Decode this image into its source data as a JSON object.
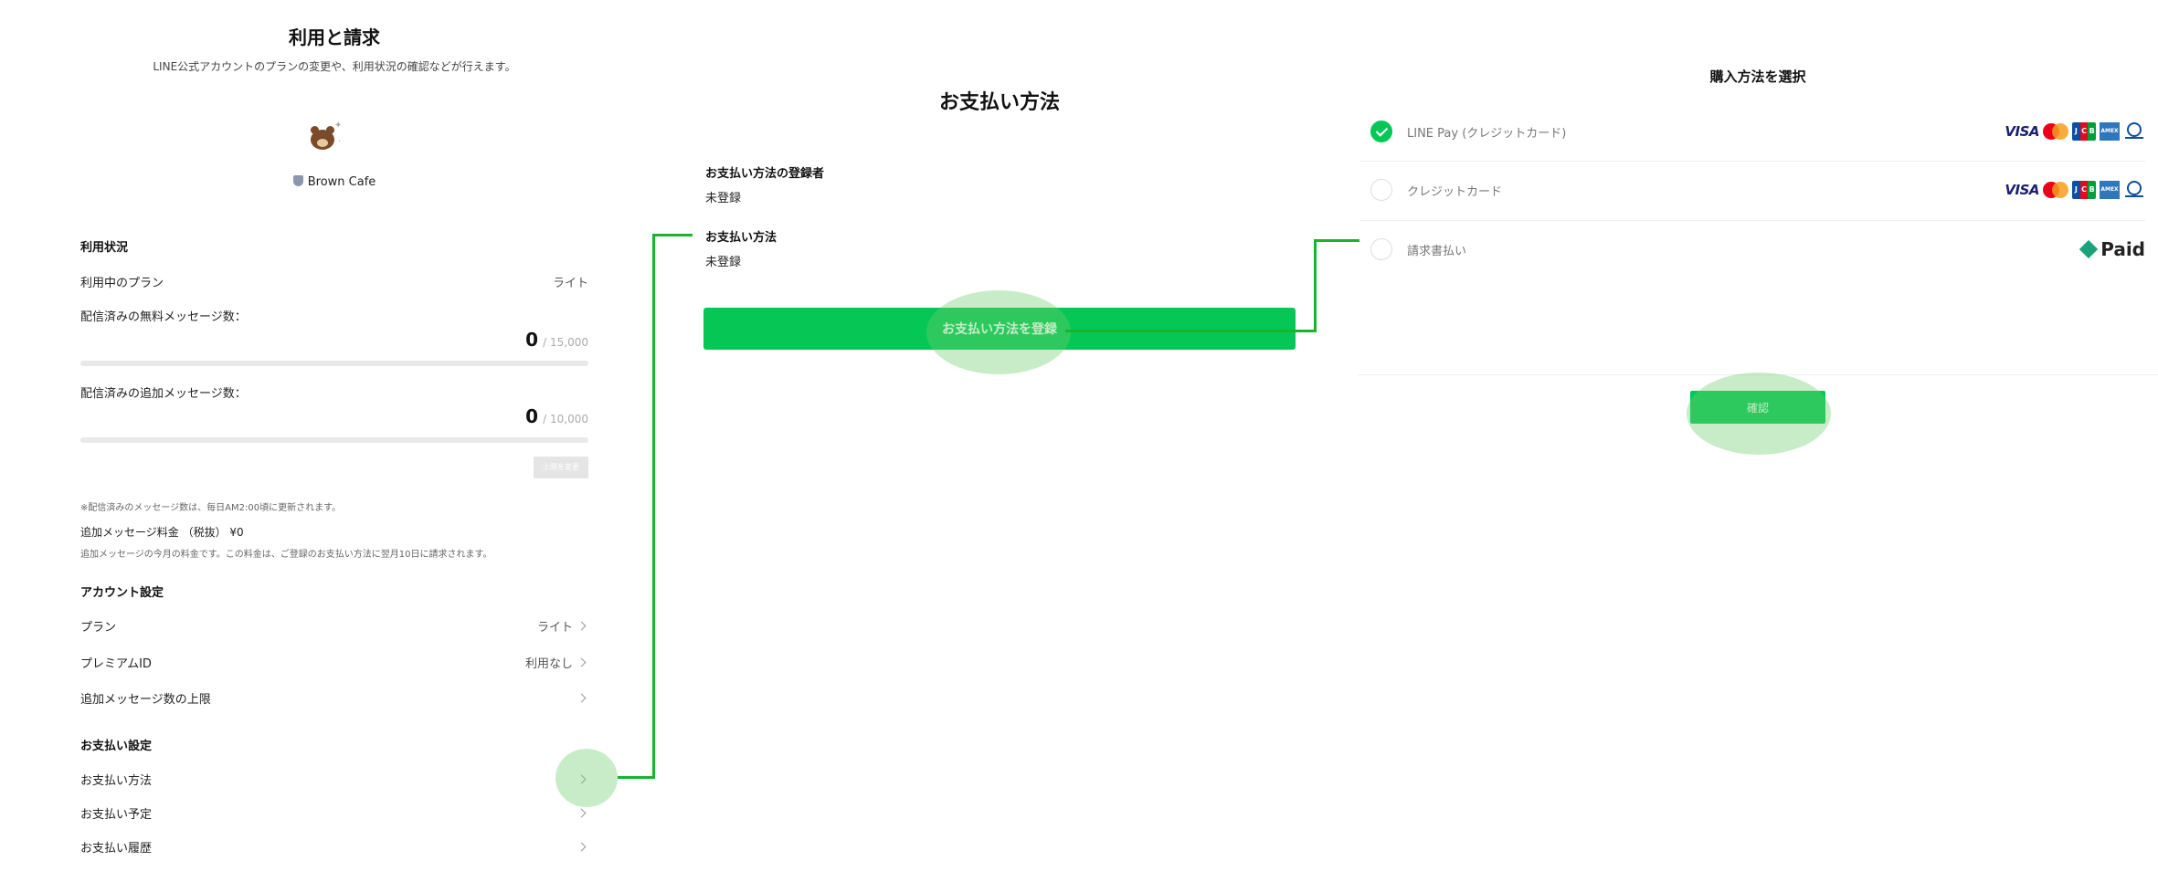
{
  "usage": {
    "title": "利用と請求",
    "subtitle": "LINE公式アカウントのプランの変更や、利用状況の確認などが行えます。",
    "account_name": "Brown Cafe",
    "status_heading": "利用状況",
    "current_plan_label": "利用中のプラン",
    "current_plan_value": "ライト",
    "free_msg_label": "配信済みの無料メッセージ数：",
    "free_msg_count": "0",
    "free_msg_limit": "/ 15,000",
    "extra_msg_label": "配信済みの追加メッセージ数：",
    "extra_msg_count": "0",
    "extra_msg_limit": "/ 10,000",
    "upper_limit_button": "上限を変更",
    "update_note": "※配信済みのメッセージ数は、毎日AM2:00頃に更新されます。",
    "extra_fee_label": "追加メッセージ料金 （税抜） ¥0",
    "extra_fee_note": "追加メッセージの今月の料金です。この料金は、ご登録のお支払い方法に翌月10日に請求されます。"
  },
  "account_settings": {
    "heading": "アカウント設定",
    "items": [
      {
        "label": "プラン",
        "value": "ライト"
      },
      {
        "label": "プレミアムID",
        "value": "利用なし"
      },
      {
        "label": "追加メッセージ数の上限",
        "value": ""
      }
    ]
  },
  "payment_settings": {
    "heading": "お支払い設定",
    "items": [
      {
        "label": "お支払い方法"
      },
      {
        "label": "お支払い予定"
      },
      {
        "label": "お支払い履歴"
      }
    ]
  },
  "payment_method": {
    "title": "お支払い方法",
    "registrant_label": "お支払い方法の登録者",
    "registrant_value": "未登録",
    "method_label": "お支払い方法",
    "method_value": "未登録",
    "register_button": "お支払い方法を登録"
  },
  "purchase": {
    "title": "購入方法を選択",
    "options": [
      {
        "label": "LINE Pay (クレジットカード)",
        "selected": true
      },
      {
        "label": "クレジットカード",
        "selected": false
      },
      {
        "label": "請求書払い",
        "selected": false
      }
    ],
    "paid_logo": "Paid",
    "confirm_button": "確認"
  },
  "colors": {
    "accent": "#06c755",
    "connector": "#16b52a",
    "highlight": "rgba(110,205,110,0.38)"
  }
}
